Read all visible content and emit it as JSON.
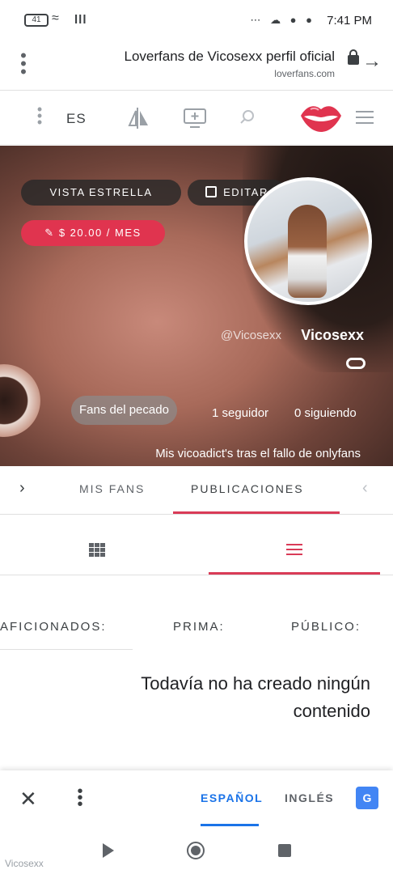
{
  "status_bar": {
    "time": "7:41 PM",
    "battery": "41",
    "notification_icons": [
      "dots-icon",
      "cloud-icon",
      "messenger-icon",
      "messenger-icon"
    ]
  },
  "browser": {
    "page_title": "Loverfans de Vicosexx perfil oficial",
    "domain": "loverfans.com"
  },
  "site_toolbar": {
    "language": "ES"
  },
  "profile": {
    "buttons": {
      "vista_estrella": "VISTA ESTRELLA",
      "editar": "EDITAR",
      "price": "$ 20.00 / MES"
    },
    "display_name": "Vicosexx",
    "handle": "@Vicosexx",
    "following": "0 siguiendo",
    "followers": "1 seguidor",
    "fans_badge": "Fans del pecado",
    "bio": "Mis vicoadict's tras el fallo de onlyfans"
  },
  "tabs": {
    "publicaciones": "PUBLICACIONES",
    "mis_fans": "MIS FANS"
  },
  "categories": {
    "publico": "PÚBLICO:",
    "prima": "PRIMA:",
    "aficionados": "AFICIONADOS:"
  },
  "empty_state": "Todavía no ha creado ningún contenido",
  "translate_bar": {
    "ingles": "INGLÉS",
    "espanol": "ESPAÑOL",
    "accent": "#1a73e8"
  },
  "nav_bar": {
    "watermark": "Vicosexx"
  },
  "colors": {
    "brand": "#d93b57",
    "price_pill": "#e0344f"
  }
}
